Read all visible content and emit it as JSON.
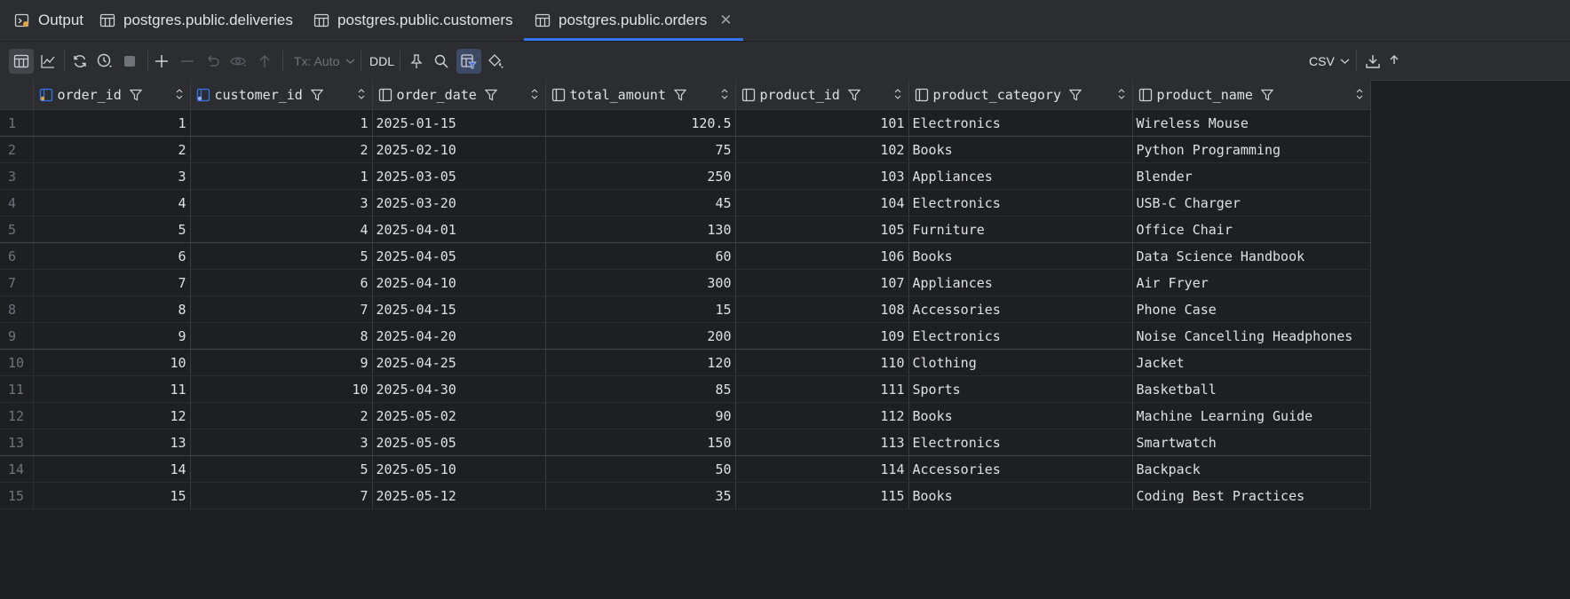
{
  "tabs": [
    {
      "label": "Output",
      "icon": "output-icon"
    },
    {
      "label": "postgres.public.deliveries",
      "icon": "table-icon"
    },
    {
      "label": "postgres.public.customers",
      "icon": "table-icon"
    },
    {
      "label": "postgres.public.orders",
      "icon": "table-icon",
      "active": true
    }
  ],
  "toolbar": {
    "tx_label": "Tx: Auto",
    "ddl_label": "DDL",
    "export_format": "CSV"
  },
  "grid": {
    "columns": [
      "order_id",
      "customer_id",
      "order_date",
      "total_amount",
      "product_id",
      "product_category",
      "product_name"
    ],
    "rows": [
      {
        "n": "1",
        "order_id": "1",
        "customer_id": "1",
        "order_date": "2025-01-15",
        "total_amount": "120.5",
        "product_id": "101",
        "product_category": "Electronics",
        "product_name": "Wireless Mouse"
      },
      {
        "n": "2",
        "order_id": "2",
        "customer_id": "2",
        "order_date": "2025-02-10",
        "total_amount": "75",
        "product_id": "102",
        "product_category": "Books",
        "product_name": "Python Programming"
      },
      {
        "n": "3",
        "order_id": "3",
        "customer_id": "1",
        "order_date": "2025-03-05",
        "total_amount": "250",
        "product_id": "103",
        "product_category": "Appliances",
        "product_name": "Blender"
      },
      {
        "n": "4",
        "order_id": "4",
        "customer_id": "3",
        "order_date": "2025-03-20",
        "total_amount": "45",
        "product_id": "104",
        "product_category": "Electronics",
        "product_name": "USB-C Charger"
      },
      {
        "n": "5",
        "order_id": "5",
        "customer_id": "4",
        "order_date": "2025-04-01",
        "total_amount": "130",
        "product_id": "105",
        "product_category": "Furniture",
        "product_name": "Office Chair"
      },
      {
        "n": "6",
        "order_id": "6",
        "customer_id": "5",
        "order_date": "2025-04-05",
        "total_amount": "60",
        "product_id": "106",
        "product_category": "Books",
        "product_name": "Data Science Handbook"
      },
      {
        "n": "7",
        "order_id": "7",
        "customer_id": "6",
        "order_date": "2025-04-10",
        "total_amount": "300",
        "product_id": "107",
        "product_category": "Appliances",
        "product_name": "Air Fryer"
      },
      {
        "n": "8",
        "order_id": "8",
        "customer_id": "7",
        "order_date": "2025-04-15",
        "total_amount": "15",
        "product_id": "108",
        "product_category": "Accessories",
        "product_name": "Phone Case"
      },
      {
        "n": "9",
        "order_id": "9",
        "customer_id": "8",
        "order_date": "2025-04-20",
        "total_amount": "200",
        "product_id": "109",
        "product_category": "Electronics",
        "product_name": "Noise Cancelling Headphones"
      },
      {
        "n": "10",
        "order_id": "10",
        "customer_id": "9",
        "order_date": "2025-04-25",
        "total_amount": "120",
        "product_id": "110",
        "product_category": "Clothing",
        "product_name": "Jacket"
      },
      {
        "n": "11",
        "order_id": "11",
        "customer_id": "10",
        "order_date": "2025-04-30",
        "total_amount": "85",
        "product_id": "111",
        "product_category": "Sports",
        "product_name": "Basketball"
      },
      {
        "n": "12",
        "order_id": "12",
        "customer_id": "2",
        "order_date": "2025-05-02",
        "total_amount": "90",
        "product_id": "112",
        "product_category": "Books",
        "product_name": "Machine Learning Guide"
      },
      {
        "n": "13",
        "order_id": "13",
        "customer_id": "3",
        "order_date": "2025-05-05",
        "total_amount": "150",
        "product_id": "113",
        "product_category": "Electronics",
        "product_name": "Smartwatch"
      },
      {
        "n": "14",
        "order_id": "14",
        "customer_id": "5",
        "order_date": "2025-05-10",
        "total_amount": "50",
        "product_id": "114",
        "product_category": "Accessories",
        "product_name": "Backpack"
      },
      {
        "n": "15",
        "order_id": "15",
        "customer_id": "7",
        "order_date": "2025-05-12",
        "total_amount": "35",
        "product_id": "115",
        "product_category": "Books",
        "product_name": "Coding Best Practices"
      }
    ]
  },
  "colors": {
    "accent": "#3574f0",
    "background": "#1e1f22",
    "panel": "#2b2d30"
  }
}
